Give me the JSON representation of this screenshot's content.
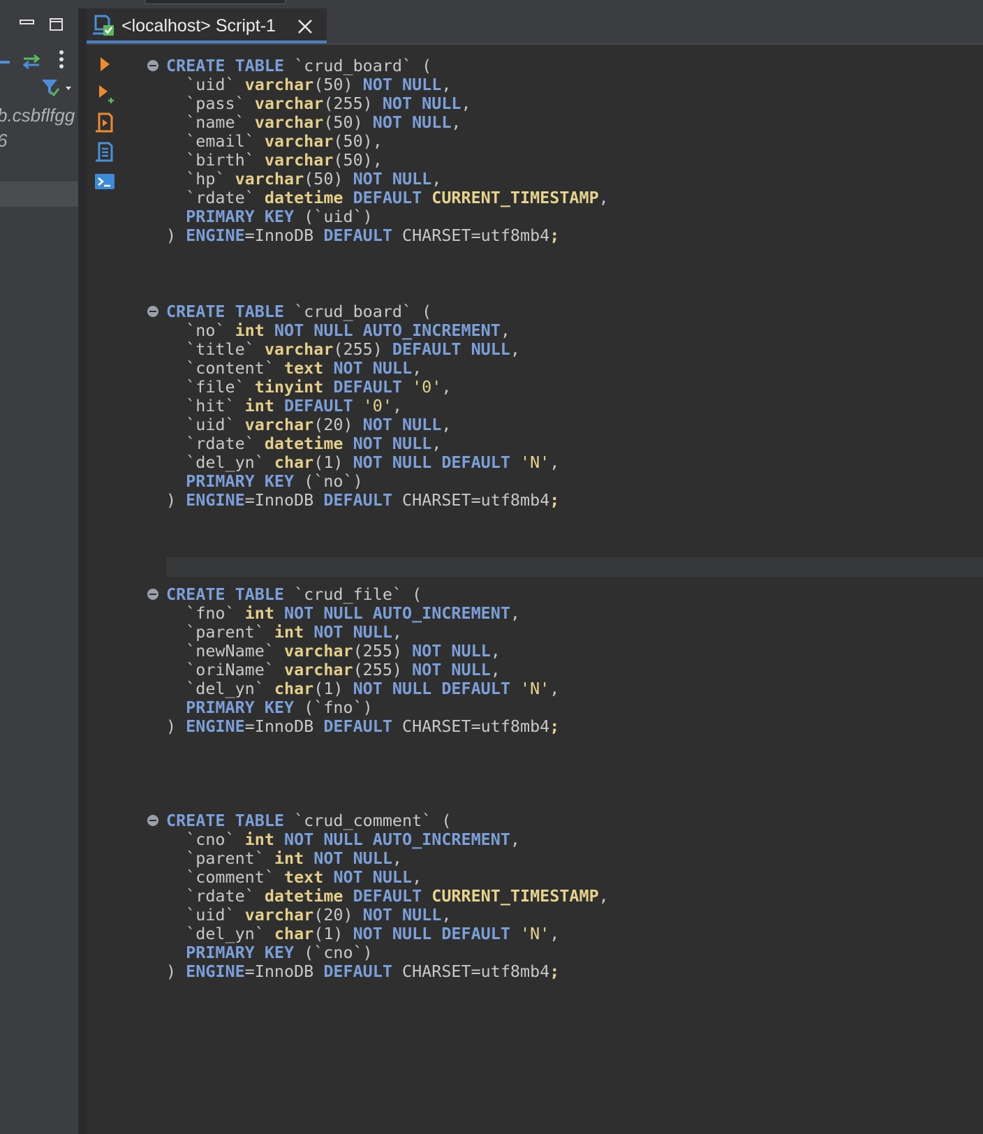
{
  "tab": {
    "label": "<localhost> Script-1"
  },
  "left_panel": {
    "connection_text": "b.csbflfgg",
    "sub_text": "6"
  },
  "sql_statements": [
    {
      "lines": [
        [
          [
            "kw",
            "CREATE TABLE"
          ],
          [
            "p",
            " `crud_board` ("
          ]
        ],
        [
          [
            "p",
            "  `uid` "
          ],
          [
            "ty",
            "varchar"
          ],
          [
            "p",
            "(50) "
          ],
          [
            "kw",
            "NOT NULL"
          ],
          [
            "p",
            ","
          ]
        ],
        [
          [
            "p",
            "  `pass` "
          ],
          [
            "ty",
            "varchar"
          ],
          [
            "p",
            "(255) "
          ],
          [
            "kw",
            "NOT NULL"
          ],
          [
            "p",
            ","
          ]
        ],
        [
          [
            "p",
            "  `name` "
          ],
          [
            "ty",
            "varchar"
          ],
          [
            "p",
            "(50) "
          ],
          [
            "kw",
            "NOT NULL"
          ],
          [
            "p",
            ","
          ]
        ],
        [
          [
            "p",
            "  `email` "
          ],
          [
            "ty",
            "varchar"
          ],
          [
            "p",
            "(50),"
          ]
        ],
        [
          [
            "p",
            "  `birth` "
          ],
          [
            "ty",
            "varchar"
          ],
          [
            "p",
            "(50),"
          ]
        ],
        [
          [
            "p",
            "  `hp` "
          ],
          [
            "ty",
            "varchar"
          ],
          [
            "p",
            "(50) "
          ],
          [
            "kw",
            "NOT NULL"
          ],
          [
            "p",
            ","
          ]
        ],
        [
          [
            "p",
            "  `rdate` "
          ],
          [
            "ty",
            "datetime"
          ],
          [
            "p",
            " "
          ],
          [
            "kw",
            "DEFAULT"
          ],
          [
            "p",
            " "
          ],
          [
            "tk",
            "CURRENT_TIMESTAMP"
          ],
          [
            "p",
            ","
          ]
        ],
        [
          [
            "p",
            "  "
          ],
          [
            "kw",
            "PRIMARY KEY"
          ],
          [
            "p",
            " (`uid`)"
          ]
        ],
        [
          [
            "p",
            ") "
          ],
          [
            "kw",
            "ENGINE"
          ],
          [
            "p",
            "=InnoDB "
          ],
          [
            "kw",
            "DEFAULT"
          ],
          [
            "p",
            " CHARSET=utf8mb4"
          ],
          [
            "tk",
            ";"
          ]
        ]
      ]
    },
    {
      "lines": [
        [
          [
            "kw",
            "CREATE TABLE"
          ],
          [
            "p",
            " `crud_board` ("
          ]
        ],
        [
          [
            "p",
            "  `no` "
          ],
          [
            "ty",
            "int"
          ],
          [
            "p",
            " "
          ],
          [
            "kw",
            "NOT NULL AUTO_INCREMENT"
          ],
          [
            "p",
            ","
          ]
        ],
        [
          [
            "p",
            "  `title` "
          ],
          [
            "ty",
            "varchar"
          ],
          [
            "p",
            "(255) "
          ],
          [
            "kw",
            "DEFAULT NULL"
          ],
          [
            "p",
            ","
          ]
        ],
        [
          [
            "p",
            "  `content` "
          ],
          [
            "ty",
            "text"
          ],
          [
            "p",
            " "
          ],
          [
            "kw",
            "NOT NULL"
          ],
          [
            "p",
            ","
          ]
        ],
        [
          [
            "p",
            "  `file` "
          ],
          [
            "ty",
            "tinyint"
          ],
          [
            "p",
            " "
          ],
          [
            "kw",
            "DEFAULT"
          ],
          [
            "p",
            " "
          ],
          [
            "str",
            "'0'"
          ],
          [
            "p",
            ","
          ]
        ],
        [
          [
            "p",
            "  `hit` "
          ],
          [
            "ty",
            "int"
          ],
          [
            "p",
            " "
          ],
          [
            "kw",
            "DEFAULT"
          ],
          [
            "p",
            " "
          ],
          [
            "str",
            "'0'"
          ],
          [
            "p",
            ","
          ]
        ],
        [
          [
            "p",
            "  `uid` "
          ],
          [
            "ty",
            "varchar"
          ],
          [
            "p",
            "(20) "
          ],
          [
            "kw",
            "NOT NULL"
          ],
          [
            "p",
            ","
          ]
        ],
        [
          [
            "p",
            "  `rdate` "
          ],
          [
            "ty",
            "datetime"
          ],
          [
            "p",
            " "
          ],
          [
            "kw",
            "NOT NULL"
          ],
          [
            "p",
            ","
          ]
        ],
        [
          [
            "p",
            "  `del_yn` "
          ],
          [
            "ty",
            "char"
          ],
          [
            "p",
            "(1) "
          ],
          [
            "kw",
            "NOT NULL DEFAULT"
          ],
          [
            "p",
            " "
          ],
          [
            "str",
            "'N'"
          ],
          [
            "p",
            ","
          ]
        ],
        [
          [
            "p",
            "  "
          ],
          [
            "kw",
            "PRIMARY KEY"
          ],
          [
            "p",
            " (`no`)"
          ]
        ],
        [
          [
            "p",
            ") "
          ],
          [
            "kw",
            "ENGINE"
          ],
          [
            "p",
            "=InnoDB "
          ],
          [
            "kw",
            "DEFAULT"
          ],
          [
            "p",
            " CHARSET=utf8mb4"
          ],
          [
            "tk",
            ";"
          ]
        ]
      ]
    },
    {
      "lines": [
        [
          [
            "kw",
            "CREATE TABLE"
          ],
          [
            "p",
            " `crud_file` ("
          ]
        ],
        [
          [
            "p",
            "  `fno` "
          ],
          [
            "ty",
            "int"
          ],
          [
            "p",
            " "
          ],
          [
            "kw",
            "NOT NULL AUTO_INCREMENT"
          ],
          [
            "p",
            ","
          ]
        ],
        [
          [
            "p",
            "  `parent` "
          ],
          [
            "ty",
            "int"
          ],
          [
            "p",
            " "
          ],
          [
            "kw",
            "NOT NULL"
          ],
          [
            "p",
            ","
          ]
        ],
        [
          [
            "p",
            "  `newName` "
          ],
          [
            "ty",
            "varchar"
          ],
          [
            "p",
            "(255) "
          ],
          [
            "kw",
            "NOT NULL"
          ],
          [
            "p",
            ","
          ]
        ],
        [
          [
            "p",
            "  `oriName` "
          ],
          [
            "ty",
            "varchar"
          ],
          [
            "p",
            "(255) "
          ],
          [
            "kw",
            "NOT NULL"
          ],
          [
            "p",
            ","
          ]
        ],
        [
          [
            "p",
            "  `del_yn` "
          ],
          [
            "ty",
            "char"
          ],
          [
            "p",
            "(1) "
          ],
          [
            "kw",
            "NOT NULL DEFAULT"
          ],
          [
            "p",
            " "
          ],
          [
            "str",
            "'N'"
          ],
          [
            "p",
            ","
          ]
        ],
        [
          [
            "p",
            "  "
          ],
          [
            "kw",
            "PRIMARY KEY"
          ],
          [
            "p",
            " (`fno`)"
          ]
        ],
        [
          [
            "p",
            ") "
          ],
          [
            "kw",
            "ENGINE"
          ],
          [
            "p",
            "=InnoDB "
          ],
          [
            "kw",
            "DEFAULT"
          ],
          [
            "p",
            " CHARSET=utf8mb4"
          ],
          [
            "tk",
            ";"
          ]
        ]
      ]
    },
    {
      "lines": [
        [
          [
            "kw",
            "CREATE TABLE"
          ],
          [
            "p",
            " `crud_comment` ("
          ]
        ],
        [
          [
            "p",
            "  `cno` "
          ],
          [
            "ty",
            "int"
          ],
          [
            "p",
            " "
          ],
          [
            "kw",
            "NOT NULL AUTO_INCREMENT"
          ],
          [
            "p",
            ","
          ]
        ],
        [
          [
            "p",
            "  `parent` "
          ],
          [
            "ty",
            "int"
          ],
          [
            "p",
            " "
          ],
          [
            "kw",
            "NOT NULL"
          ],
          [
            "p",
            ","
          ]
        ],
        [
          [
            "p",
            "  `comment` "
          ],
          [
            "ty",
            "text"
          ],
          [
            "p",
            " "
          ],
          [
            "kw",
            "NOT NULL"
          ],
          [
            "p",
            ","
          ]
        ],
        [
          [
            "p",
            "  `rdate` "
          ],
          [
            "ty",
            "datetime"
          ],
          [
            "p",
            " "
          ],
          [
            "kw",
            "DEFAULT"
          ],
          [
            "p",
            " "
          ],
          [
            "tk",
            "CURRENT_TIMESTAMP"
          ],
          [
            "p",
            ","
          ]
        ],
        [
          [
            "p",
            "  `uid` "
          ],
          [
            "ty",
            "varchar"
          ],
          [
            "p",
            "(20) "
          ],
          [
            "kw",
            "NOT NULL"
          ],
          [
            "p",
            ","
          ]
        ],
        [
          [
            "p",
            "  `del_yn` "
          ],
          [
            "ty",
            "char"
          ],
          [
            "p",
            "(1) "
          ],
          [
            "kw",
            "NOT NULL DEFAULT"
          ],
          [
            "p",
            " "
          ],
          [
            "str",
            "'N'"
          ],
          [
            "p",
            ","
          ]
        ],
        [
          [
            "p",
            "  "
          ],
          [
            "kw",
            "PRIMARY KEY"
          ],
          [
            "p",
            " (`cno`)"
          ]
        ],
        [
          [
            "p",
            ") "
          ],
          [
            "kw",
            "ENGINE"
          ],
          [
            "p",
            "=InnoDB "
          ],
          [
            "kw",
            "DEFAULT"
          ],
          [
            "p",
            " CHARSET=utf8mb4"
          ],
          [
            "tk",
            ";"
          ]
        ]
      ]
    }
  ]
}
